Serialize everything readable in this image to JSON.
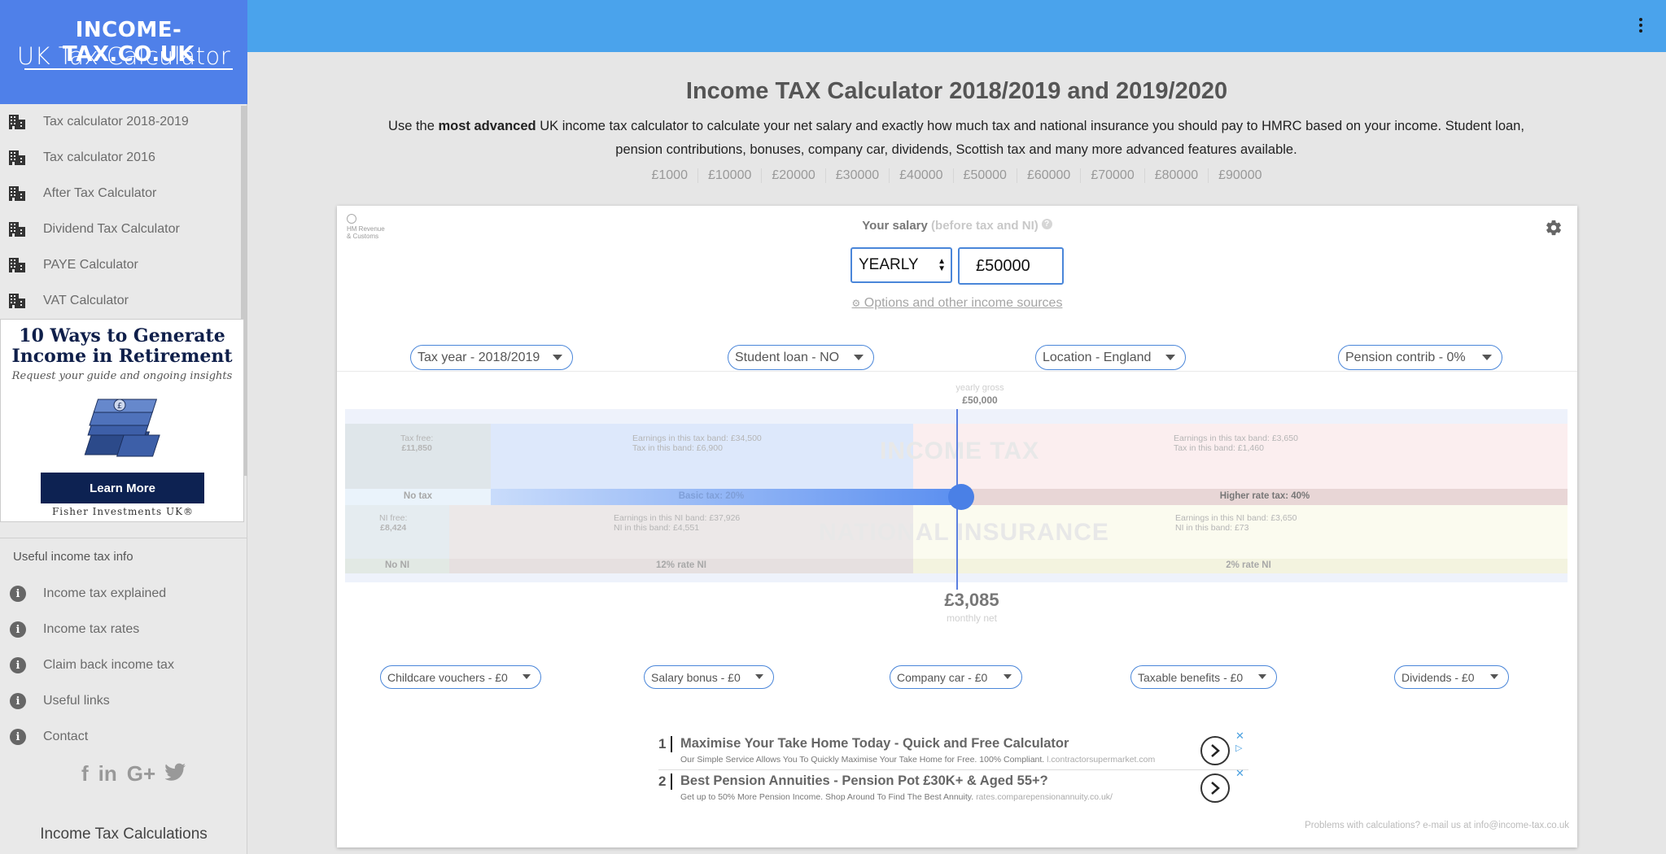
{
  "brand": {
    "top": "INCOME-TAX.CO.UK",
    "bottom": "UK Tax Calculator"
  },
  "nav": [
    {
      "label": "Tax calculator 2018-2019",
      "icon": "building-icon"
    },
    {
      "label": "Tax calculator 2016",
      "icon": "building-icon"
    },
    {
      "label": "After Tax Calculator",
      "icon": "building-icon"
    },
    {
      "label": "Dividend Tax Calculator",
      "icon": "building-icon"
    },
    {
      "label": "PAYE Calculator",
      "icon": "building-icon"
    },
    {
      "label": "VAT Calculator",
      "icon": "building-icon"
    }
  ],
  "side_ad": {
    "title_line1": "10 Ways to Generate",
    "title_line2": "Income in Retirement",
    "subtitle": "Request your guide and ongoing insights",
    "button": "Learn More",
    "brand": "Fisher Investments UK®"
  },
  "info": {
    "heading": "Useful income tax info",
    "items": [
      "Income tax explained",
      "Income tax rates",
      "Claim back income tax",
      "Useful links",
      "Contact"
    ]
  },
  "social": {
    "facebook": "f",
    "linkedin": "in",
    "googleplus": "G+"
  },
  "side_footer": "Income Tax Calculations",
  "main": {
    "title": "Income TAX Calculator 2018/2019 and 2019/2020",
    "desc_pre": "Use the ",
    "desc_bold": "most advanced",
    "desc_post": " UK income tax calculator to calculate your net salary and exactly how much tax and national insurance you should pay to HMRC based on your income. Student loan, pension contributions, bonuses, company car, dividends, Scottish tax and many more advanced features available.",
    "salary_links": [
      "£1000",
      "£10000",
      "£20000",
      "£30000",
      "£40000",
      "£50000",
      "£60000",
      "£70000",
      "£80000",
      "£90000"
    ]
  },
  "calc": {
    "hmrc_line1": "HM Revenue",
    "hmrc_line2": "& Customs",
    "salary_label": "Your salary",
    "salary_hint": "(before tax and NI)",
    "help": "?",
    "period": "YEARLY",
    "salary_value": "£50000",
    "options_cog": "⚙",
    "options_link": " Options and other income sources",
    "pills_top": [
      "Tax year - 2018/2019",
      "Student loan - NO",
      "Location - England",
      "Pension contrib - 0%"
    ],
    "pills_bottom": [
      "Childcare vouchers - £0",
      "Salary bonus - £0",
      "Company car - £0",
      "Taxable benefits - £0",
      "Dividends - £0"
    ]
  },
  "viz": {
    "gross_label": "yearly gross",
    "gross_value": "£50,000",
    "tax_free_label": "Tax free:",
    "tax_free_value": "£11,850",
    "basic_earn": "Earnings in this tax band: £34,500",
    "basic_tax": "Tax in this band: £6,900",
    "higher_earn": "Earnings in this tax band: £3,650",
    "higher_tax": "Tax in this band: £1,460",
    "income_tax": "INCOME TAX",
    "no_tax": "No tax",
    "basic_band": "Basic tax: 20%",
    "higher_band": "Higher rate tax: 40%",
    "ni_free_label": "NI free:",
    "ni_free_value": "£8,424",
    "ni12_earn": "Earnings in this NI band: £37,926",
    "ni12_tax": "NI in this band: £4,551",
    "ni2_earn": "Earnings in this NI band: £3,650",
    "ni2_tax": "NI in this band: £73",
    "national_insurance": "NATIONAL INSURANCE",
    "no_ni": "No NI",
    "ni12_band": "12% rate NI",
    "ni2_band": "2% rate NI",
    "monthly_net": "£3,085",
    "monthly_net_label": "monthly net"
  },
  "ads": [
    {
      "num": "1",
      "headline": "Maximise Your Take Home Today - Quick and Free Calculator",
      "desc": "Our Simple Service Allows You To Quickly Maximise Your Take Home for Free. 100% Compliant.",
      "url": "l.contractorsupermarket.com"
    },
    {
      "num": "2",
      "headline": "Best Pension Annuities - Pension Pot £30K+ & Aged 55+?",
      "desc": "Get up to 50% More Pension Income. Shop Around To Find The Best Annuity.",
      "url": "rates.comparepensionannuity.co.uk/"
    }
  ],
  "problems": "Problems with calculations? e-mail us at info@income-tax.co.uk",
  "colors": {
    "brand_blue": "#4f80e9",
    "topbar_blue": "#4aa3ec",
    "accent": "#4a86d9"
  }
}
